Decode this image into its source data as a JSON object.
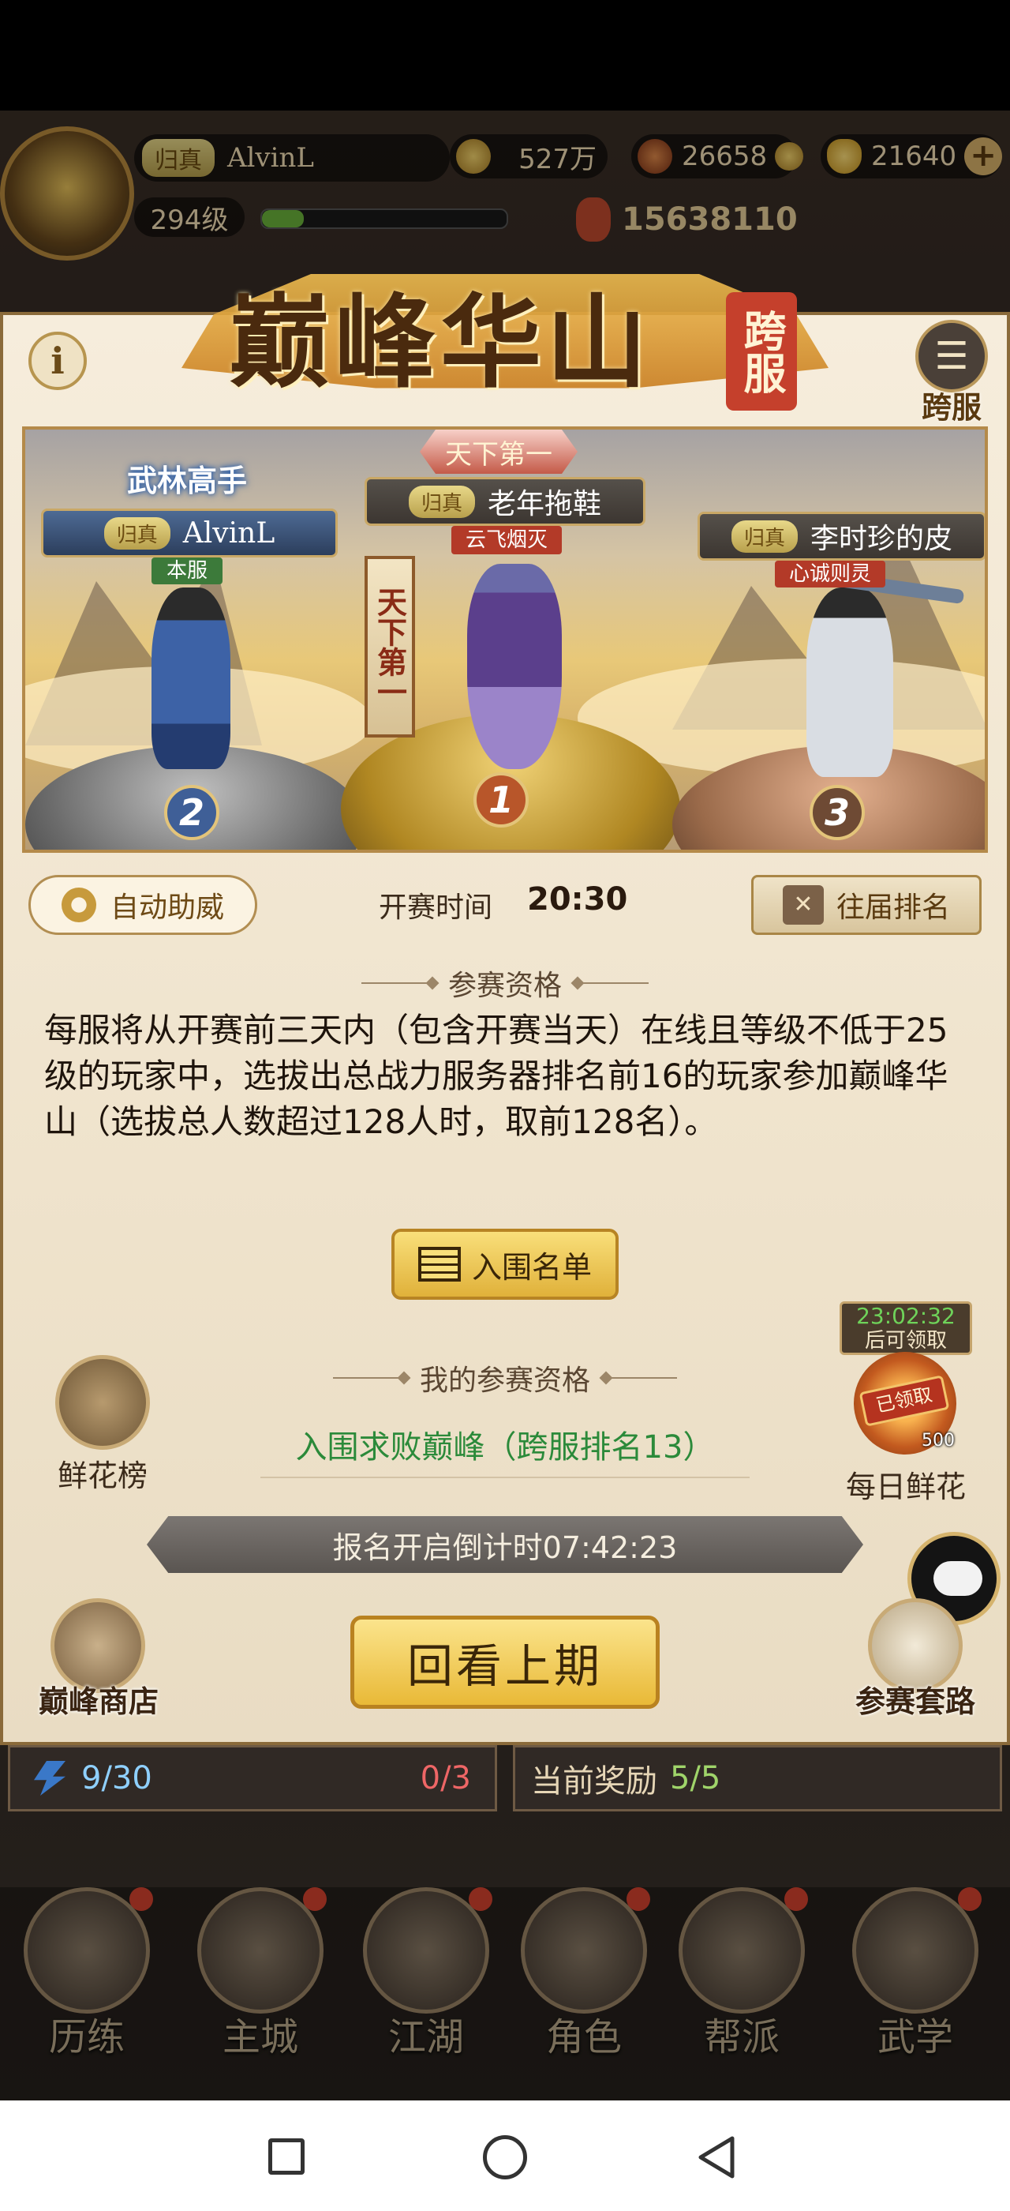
{
  "top_hud": {
    "realm_tag": "归真",
    "player_name": "AlvinL",
    "level": "294级",
    "silver": "527万",
    "resource_2": "26658",
    "gold": "21640",
    "power": "15638110",
    "level_progress": 0.17
  },
  "panel": {
    "title": "巅峰华山",
    "cross_server_badge": "跨服",
    "info_label": "i",
    "cross_menu_label": "跨服",
    "podium": {
      "first_title": "天下第一",
      "first_side_plate": "天下第一",
      "first_realm": "归真",
      "first_name": "老年拖鞋",
      "first_server": "云飞烟灭",
      "first_rank": "1",
      "second_title": "武林高手",
      "second_realm": "归真",
      "second_name": "AlvinL",
      "second_server": "本服",
      "second_rank": "2",
      "third_realm": "归真",
      "third_name": "李时珍的皮",
      "third_server": "心诚则灵",
      "third_rank": "3"
    },
    "auto_cheer_button": "自动助威",
    "start_time_label": "开赛时间",
    "start_time_value": "20:30",
    "history_rank_button": "往届排名",
    "qualification_heading": "参赛资格",
    "qualification_text": "每服将从开赛前三天内（包含开赛当天）在线且等级不低于25级的玩家中，选拔出总战力服务器排名前16的玩家参加巅峰华山（选拔总人数超过128人时，取前128名）。",
    "shortlist_button": "入围名单",
    "my_qualification_heading": "我的参赛资格",
    "my_qualification_value": "入围求败巅峰（跨服排名13）",
    "flower_rank_label": "鲜花榜",
    "daily_flower_timer": "23:02:32",
    "daily_flower_timer_sub": "后可领取",
    "daily_flower_claimed": "已领取",
    "daily_flower_count": "500",
    "daily_flower_label": "每日鲜花",
    "signup_countdown": "报名开启倒计时07:42:23",
    "peak_shop_label": "巅峰商店",
    "replay_button": "回看上期",
    "tactics_label": "参赛套路"
  },
  "below_panel": {
    "stamina": "9/30",
    "tickets": "0/3",
    "reward_label": "当前奖励",
    "reward_value": "5/5"
  },
  "bottom_nav": [
    "历练",
    "主城",
    "江湖",
    "角色",
    "帮派",
    "武学"
  ],
  "colors": {
    "panel_bg": "#f1e6d0",
    "accent_gold": "#e6b43a",
    "qualified_green": "#2b8a3a",
    "timer_green": "#6fd35a"
  }
}
